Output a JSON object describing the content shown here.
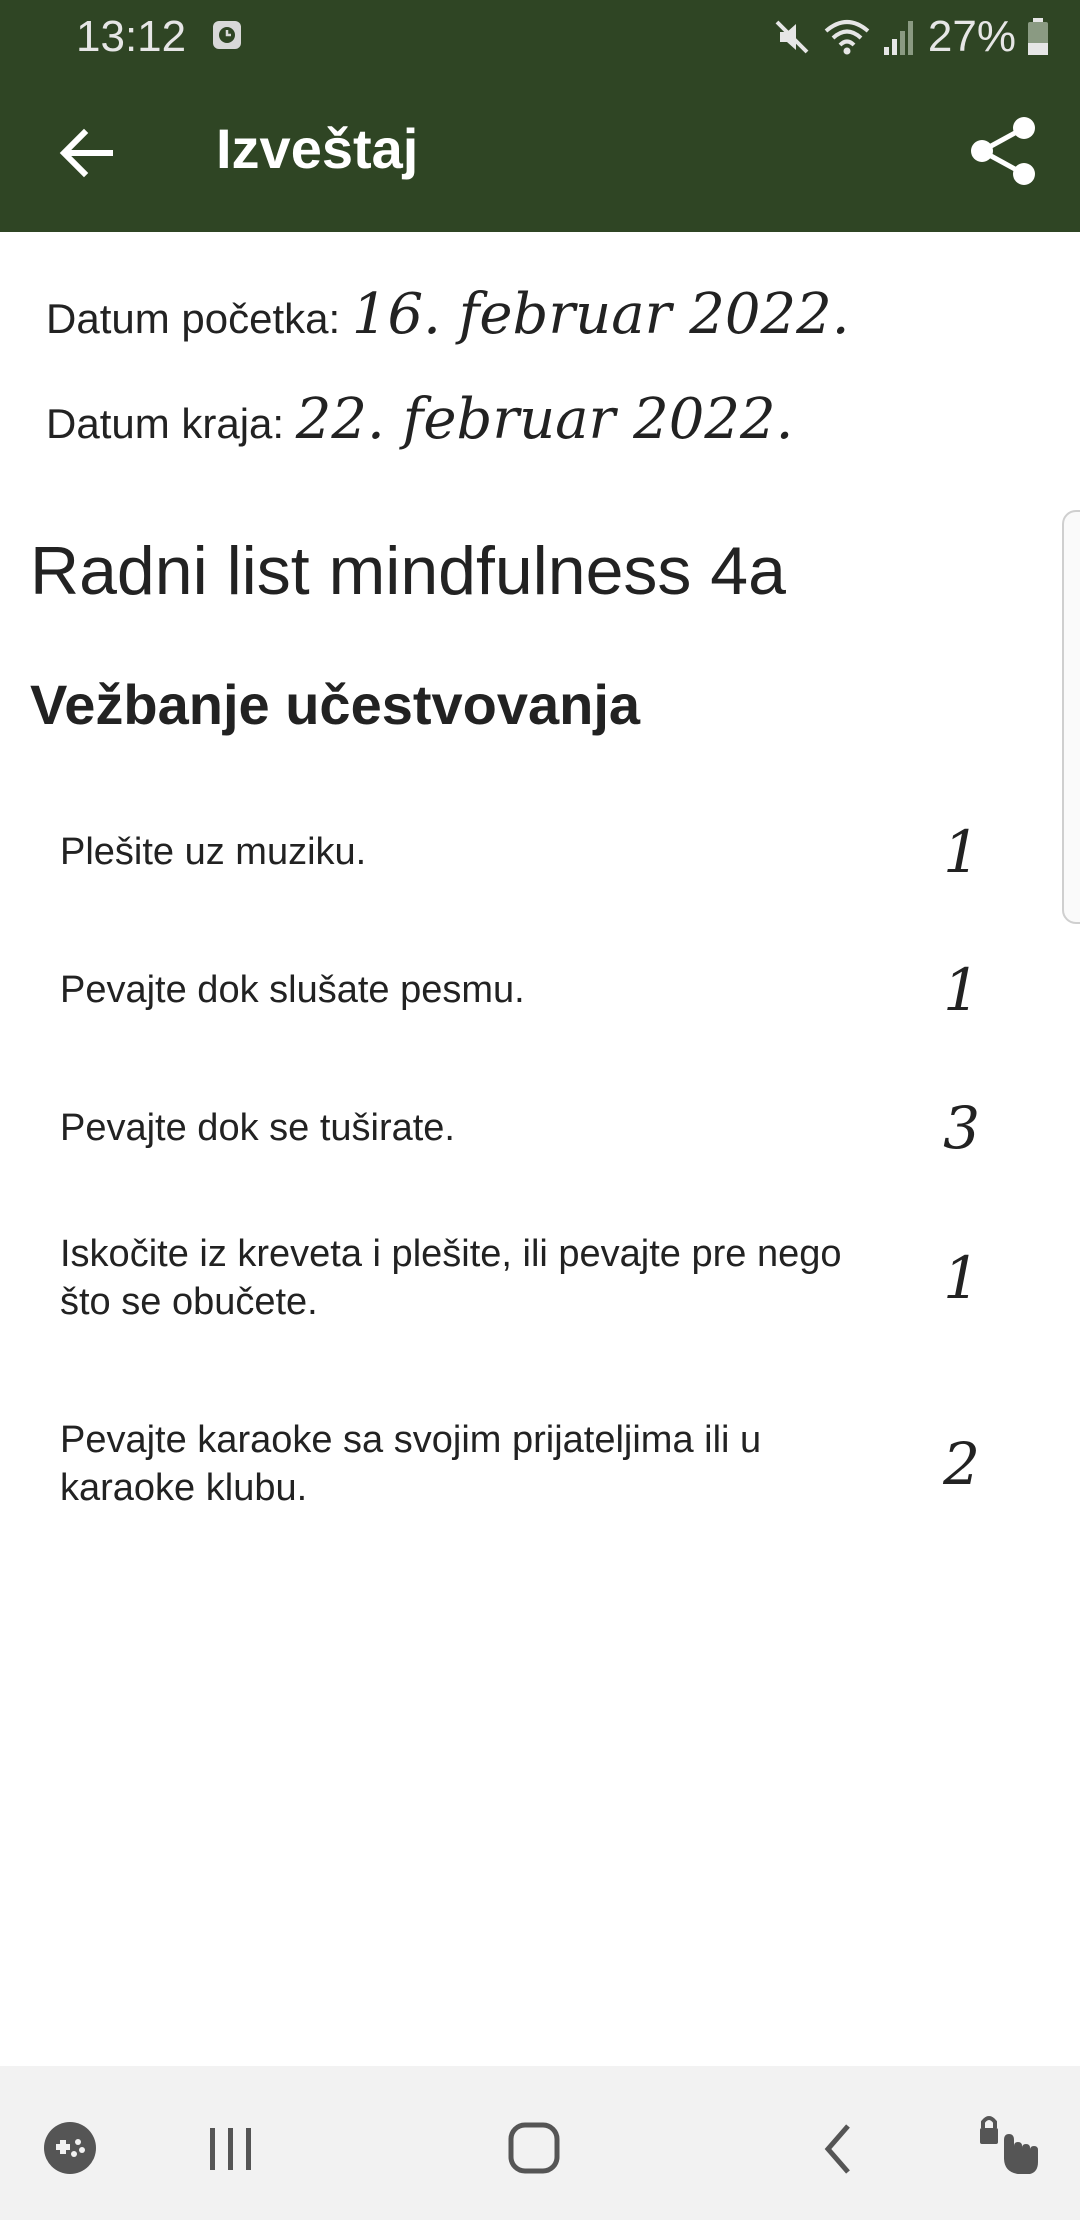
{
  "status": {
    "time": "13:12",
    "battery": "27%"
  },
  "appbar": {
    "title": "Izveštaj"
  },
  "dates": {
    "start_label": "Datum početka:",
    "start_value": "16. februar 2022.",
    "end_label": "Datum kraja:",
    "end_value": "22. februar 2022."
  },
  "worksheet_title": "Radni list mindfulness 4a",
  "section_title": "Vežbanje učestvovanja",
  "items": [
    {
      "text": "Plešite uz muziku.",
      "count": "1"
    },
    {
      "text": "Pevajte dok slušate pesmu.",
      "count": "1"
    },
    {
      "text": "Pevajte dok se tuširate.",
      "count": "3"
    },
    {
      "text": "Iskočite iz kreveta i plešite, ili pevajte pre nego što se obučete.",
      "count": "1"
    },
    {
      "text": "Pevajte karaoke sa svojim prijateljima ili u karaoke klubu.",
      "count": "2"
    }
  ],
  "colors": {
    "appbar": "#2f4524",
    "navbar": "#f2f2f2"
  }
}
